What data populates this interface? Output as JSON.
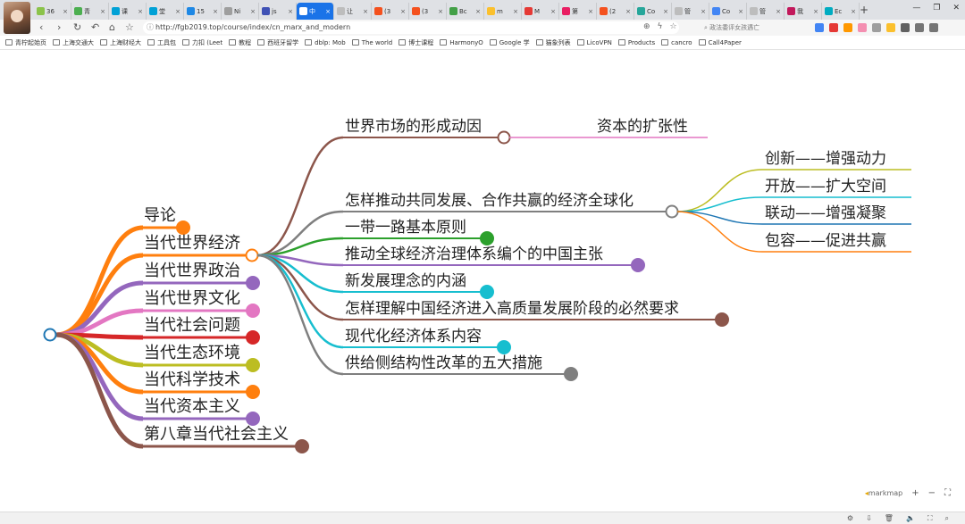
{
  "browser": {
    "tabs": [
      {
        "label": "36",
        "color": "#8bc34a"
      },
      {
        "label": "青",
        "color": "#4caf50"
      },
      {
        "label": "课",
        "color": "#00a1d6"
      },
      {
        "label": "堂",
        "color": "#00a1d6"
      },
      {
        "label": "15",
        "color": "#1e88e5"
      },
      {
        "label": "Ni",
        "color": "#9e9e9e"
      },
      {
        "label": "js",
        "color": "#3f51b5"
      },
      {
        "label": "中",
        "color": "#ffffff",
        "active": true
      },
      {
        "label": "让",
        "color": "#bdbdbd"
      },
      {
        "label": "(3",
        "color": "#f4511e"
      },
      {
        "label": "(3",
        "color": "#f4511e"
      },
      {
        "label": "Bc",
        "color": "#43a047"
      },
      {
        "label": "m",
        "color": "#fbc02d"
      },
      {
        "label": "M",
        "color": "#e53935"
      },
      {
        "label": "第",
        "color": "#e91e63"
      },
      {
        "label": "(2",
        "color": "#f4511e"
      },
      {
        "label": "Co",
        "color": "#26a69a"
      },
      {
        "label": "管",
        "color": "#bdbdbd"
      },
      {
        "label": "Co",
        "color": "#4285f4"
      },
      {
        "label": "管",
        "color": "#bdbdbd"
      },
      {
        "label": "我",
        "color": "#c2185b"
      },
      {
        "label": "Ec",
        "color": "#00acc1"
      }
    ],
    "url": "http://fgb2019.top/course/index/cn_marx_and_modern",
    "search_placeholder": "政法委评女孩遇亡",
    "bookmarks": [
      "青柠起始页",
      "上海交通大",
      "上海财经大",
      "工具包",
      "力扣 (Leet",
      "教程",
      "西班牙留学",
      "dblp: Mob",
      "The world",
      "博士课程",
      "HarmonyO",
      "Google 学",
      "猫象列表",
      "LicoVPN",
      "Products",
      "cancro",
      "Call4Paper"
    ],
    "window_controls": [
      "—",
      "❐",
      "✕"
    ]
  },
  "mindmap": {
    "root": "",
    "level1": [
      {
        "label": "导论",
        "color": "#ff7f0e"
      },
      {
        "label": "当代世界经济",
        "color": "#ff7f0e",
        "expanded": true
      },
      {
        "label": "当代世界政治",
        "color": "#9467bd"
      },
      {
        "label": "当代世界文化",
        "color": "#e377c2"
      },
      {
        "label": "当代社会问题",
        "color": "#d62728"
      },
      {
        "label": "当代生态环境",
        "color": "#bcbd22"
      },
      {
        "label": "当代科学技术",
        "color": "#ff7f0e"
      },
      {
        "label": "当代资本主义",
        "color": "#9467bd"
      },
      {
        "label": "第八章当代社会主义",
        "color": "#8c564b"
      }
    ],
    "economy_children": [
      {
        "label": "世界市场的形成动因",
        "color": "#8c564b",
        "expanded": true
      },
      {
        "label": "怎样推动共同发展、合作共赢的经济全球化",
        "color": "#7f7f7f",
        "expanded": true
      },
      {
        "label": "一带一路基本原则",
        "color": "#2ca02c"
      },
      {
        "label": "推动全球经济治理体系编个的中国主张",
        "color": "#9467bd"
      },
      {
        "label": "新发展理念的内涵",
        "color": "#17becf"
      },
      {
        "label": "怎样理解中国经济进入高质量发展阶段的必然要求",
        "color": "#8c564b"
      },
      {
        "label": "现代化经济体系内容",
        "color": "#17becf"
      },
      {
        "label": "供给侧结构性改革的五大措施",
        "color": "#7f7f7f"
      }
    ],
    "market_children": [
      {
        "label": "资本的扩张性",
        "color": "#e377c2"
      }
    ],
    "globalization_children": [
      {
        "label": "创新——增强动力",
        "color": "#bcbd22"
      },
      {
        "label": "开放——扩大空间",
        "color": "#17becf"
      },
      {
        "label": "联动——增强凝聚",
        "color": "#1f77b4"
      },
      {
        "label": "包容——促进共赢",
        "color": "#ff7f0e"
      }
    ],
    "root_color": "#1f77b4"
  },
  "markmap_toolbar": {
    "brand": "markmap",
    "buttons": [
      "+",
      "−",
      "⛶"
    ]
  }
}
